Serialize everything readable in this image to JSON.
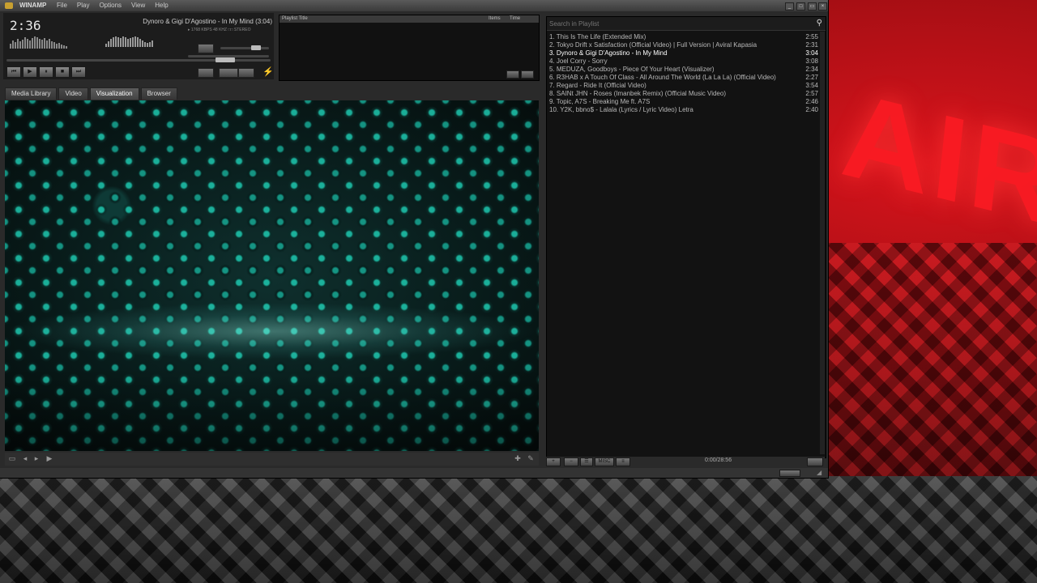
{
  "window": {
    "app_title": "WINAMP",
    "menu": [
      "File",
      "Play",
      "Options",
      "View",
      "Help"
    ]
  },
  "player": {
    "elapsed": "2:36",
    "track_title": "Dynoro & Gigi D'Agostino - In My Mind (3:04)",
    "bitrate_info": "▸ 1768 KBPS   48 KHZ   □□ STEREO",
    "transport": {
      "prev": "⏮",
      "play": "▶",
      "pause": "⏸",
      "stop": "■",
      "next": "⏭"
    }
  },
  "mini_playlist": {
    "col_title": "Playlist Title",
    "col_items": "Items",
    "col_time": "Time"
  },
  "tabs": [
    "Media Library",
    "Video",
    "Visualization",
    "Browser"
  ],
  "active_tab": "Visualization",
  "playlist": {
    "search_placeholder": "Search in Playlist",
    "items": [
      {
        "title": "1. This Is The Life (Extended Mix)",
        "duration": "2:55"
      },
      {
        "title": "2. Tokyo Drift x Satisfaction (Official Video)  |  Full Version  |  Aviral Kapasia",
        "duration": "2:31"
      },
      {
        "title": "3. Dynoro & Gigi D'Agostino - In My Mind",
        "duration": "3:04"
      },
      {
        "title": "4. Joel Corry - Sorry",
        "duration": "3:08"
      },
      {
        "title": "5. MEDUZA, Goodboys - Piece Of Your Heart (Visualizer)",
        "duration": "2:34"
      },
      {
        "title": "6. R3HAB x A Touch Of Class - All Around The World (La La La) (Official Video)",
        "duration": "2:27"
      },
      {
        "title": "7. Regard - Ride It (Official Video)",
        "duration": "3:54"
      },
      {
        "title": "8. SAINt JHN - Roses (Imanbek Remix) (Official Music Video)",
        "duration": "2:57"
      },
      {
        "title": "9. Topic, A7S - Breaking Me ft. A7S",
        "duration": "2:46"
      },
      {
        "title": "10. Y2K, bbno$ - Lalala (Lyrics / Lyric Video) Letra",
        "duration": "2:40"
      }
    ],
    "current_index": 2,
    "footer_time": "0:00/28:56",
    "footer_buttons": [
      "+",
      "−",
      "☰",
      "MISC",
      "≡"
    ]
  },
  "background": {
    "sign_text": "AIR"
  },
  "colors": {
    "accent_cyan": "#1ec9b0",
    "sign_red": "#ff1c24"
  }
}
